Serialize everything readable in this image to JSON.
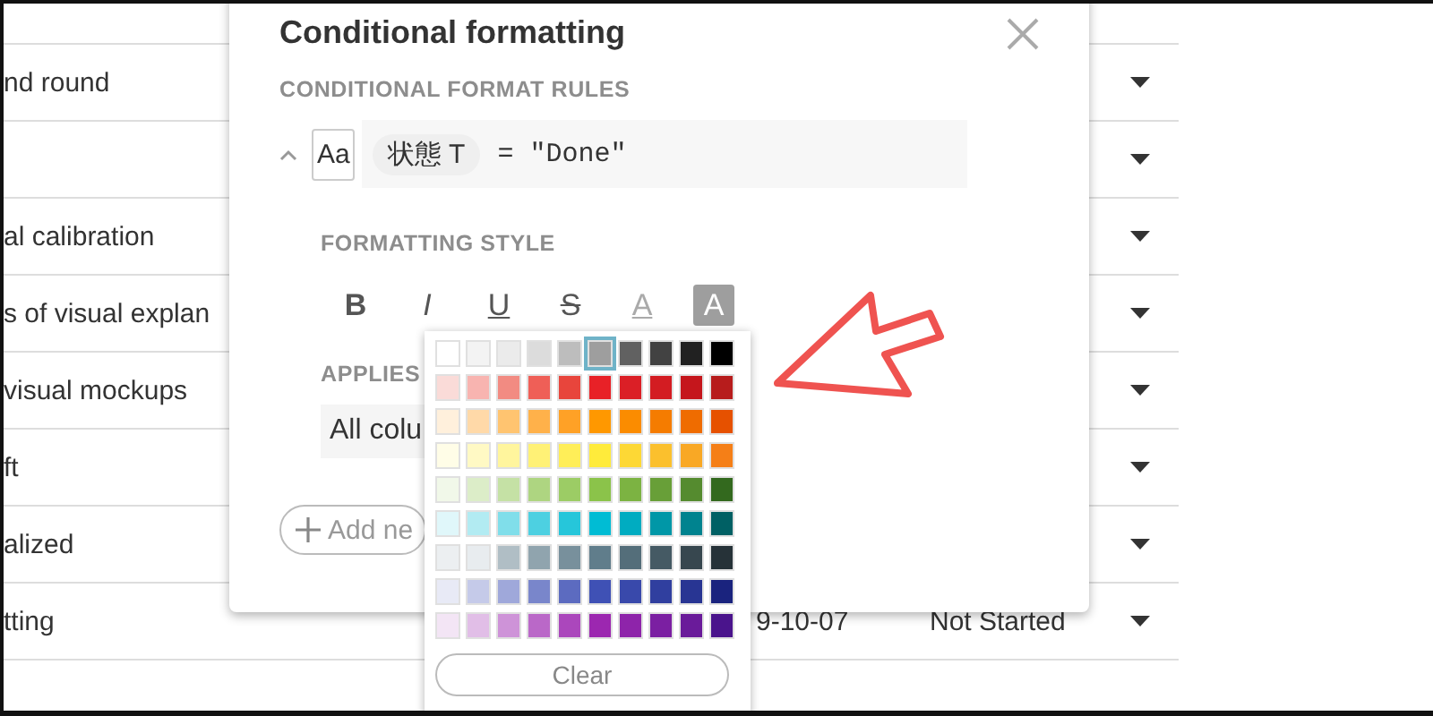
{
  "table": {
    "rows": [
      {
        "name": "nd round"
      },
      {},
      {
        "name": "al calibration"
      },
      {
        "name": "s of visual explan"
      },
      {
        "name": "visual mockups"
      },
      {
        "name": "ft"
      },
      {
        "name": "alized"
      },
      {
        "name": "tting",
        "date": "9-10-07",
        "status": "Not Started"
      }
    ]
  },
  "dialog": {
    "title": "Conditional formatting",
    "rules_heading": "CONDITIONAL FORMAT RULES",
    "rule": {
      "expanded": true,
      "format_sample": "Aa",
      "field": "状態",
      "field_type": "T",
      "condition": "= \"Done\""
    },
    "style_heading": "FORMATTING STYLE",
    "style_buttons": [
      {
        "kind": "bold",
        "label": "B",
        "selected": false
      },
      {
        "kind": "italic",
        "label": "I",
        "selected": false
      },
      {
        "kind": "underline",
        "label": "U",
        "selected": false
      },
      {
        "kind": "strike",
        "label": "S",
        "selected": false
      },
      {
        "kind": "text-color",
        "label": "A",
        "selected": false
      },
      {
        "kind": "fill-color",
        "label": "A",
        "selected": true
      }
    ],
    "applies_heading": "APPLIES",
    "applies_value": "All colu",
    "add_button": "Add ne"
  },
  "palette": {
    "rows": [
      {
        "swatches": [
          {
            "color": "#ffffff",
            "selected": false
          },
          {
            "color": "#f3f3f3",
            "selected": false
          },
          {
            "color": "#ebebeb",
            "selected": false
          },
          {
            "color": "#dcdcdc",
            "selected": false
          },
          {
            "color": "#bdbdbd",
            "selected": false
          },
          {
            "color": "#9e9e9e",
            "selected": true
          },
          {
            "color": "#616161",
            "selected": false
          },
          {
            "color": "#424242",
            "selected": false
          },
          {
            "color": "#212121",
            "selected": false
          },
          {
            "color": "#000000",
            "selected": false
          }
        ]
      },
      {
        "swatches": [
          {
            "color": "#fadbd8",
            "selected": false
          },
          {
            "color": "#f8b4b0",
            "selected": false
          },
          {
            "color": "#f28b82",
            "selected": false
          },
          {
            "color": "#ef5f57",
            "selected": false
          },
          {
            "color": "#e8453c",
            "selected": false
          },
          {
            "color": "#e82127",
            "selected": false
          },
          {
            "color": "#db1f26",
            "selected": false
          },
          {
            "color": "#d31c22",
            "selected": false
          },
          {
            "color": "#c5161c",
            "selected": false
          },
          {
            "color": "#b71c1c",
            "selected": false
          }
        ]
      },
      {
        "swatches": [
          {
            "color": "#fff0dc",
            "selected": false
          },
          {
            "color": "#ffd9a8",
            "selected": false
          },
          {
            "color": "#ffc470",
            "selected": false
          },
          {
            "color": "#ffb14a",
            "selected": false
          },
          {
            "color": "#ffa126",
            "selected": false
          },
          {
            "color": "#ff9800",
            "selected": false
          },
          {
            "color": "#fb8c00",
            "selected": false
          },
          {
            "color": "#f57c00",
            "selected": false
          },
          {
            "color": "#ef6c00",
            "selected": false
          },
          {
            "color": "#e65100",
            "selected": false
          }
        ]
      },
      {
        "swatches": [
          {
            "color": "#fffde7",
            "selected": false
          },
          {
            "color": "#fff9c4",
            "selected": false
          },
          {
            "color": "#fff59d",
            "selected": false
          },
          {
            "color": "#fff176",
            "selected": false
          },
          {
            "color": "#ffee58",
            "selected": false
          },
          {
            "color": "#ffeb3b",
            "selected": false
          },
          {
            "color": "#fdd835",
            "selected": false
          },
          {
            "color": "#fbc02d",
            "selected": false
          },
          {
            "color": "#f9a825",
            "selected": false
          },
          {
            "color": "#f57f17",
            "selected": false
          }
        ]
      },
      {
        "swatches": [
          {
            "color": "#f1f8e9",
            "selected": false
          },
          {
            "color": "#dcedc8",
            "selected": false
          },
          {
            "color": "#c5e1a5",
            "selected": false
          },
          {
            "color": "#aed581",
            "selected": false
          },
          {
            "color": "#9ccc65",
            "selected": false
          },
          {
            "color": "#8bc34a",
            "selected": false
          },
          {
            "color": "#7cb342",
            "selected": false
          },
          {
            "color": "#689f38",
            "selected": false
          },
          {
            "color": "#558b2f",
            "selected": false
          },
          {
            "color": "#33691e",
            "selected": false
          }
        ]
      },
      {
        "swatches": [
          {
            "color": "#e0f7fa",
            "selected": false
          },
          {
            "color": "#b2ebf2",
            "selected": false
          },
          {
            "color": "#80deea",
            "selected": false
          },
          {
            "color": "#4dd0e1",
            "selected": false
          },
          {
            "color": "#26c6da",
            "selected": false
          },
          {
            "color": "#00bcd4",
            "selected": false
          },
          {
            "color": "#00acc1",
            "selected": false
          },
          {
            "color": "#0097a7",
            "selected": false
          },
          {
            "color": "#00838f",
            "selected": false
          },
          {
            "color": "#006064",
            "selected": false
          }
        ]
      },
      {
        "swatches": [
          {
            "color": "#eceff1",
            "selected": false
          },
          {
            "color": "#e8ecef",
            "selected": false
          },
          {
            "color": "#b0bec5",
            "selected": false
          },
          {
            "color": "#90a4ae",
            "selected": false
          },
          {
            "color": "#78909c",
            "selected": false
          },
          {
            "color": "#607d8b",
            "selected": false
          },
          {
            "color": "#546e7a",
            "selected": false
          },
          {
            "color": "#455a64",
            "selected": false
          },
          {
            "color": "#37474f",
            "selected": false
          },
          {
            "color": "#263238",
            "selected": false
          }
        ]
      },
      {
        "swatches": [
          {
            "color": "#e8eaf6",
            "selected": false
          },
          {
            "color": "#c5cae9",
            "selected": false
          },
          {
            "color": "#9fa8da",
            "selected": false
          },
          {
            "color": "#7986cb",
            "selected": false
          },
          {
            "color": "#5c6bc0",
            "selected": false
          },
          {
            "color": "#3f51b5",
            "selected": false
          },
          {
            "color": "#3949ab",
            "selected": false
          },
          {
            "color": "#303f9f",
            "selected": false
          },
          {
            "color": "#283593",
            "selected": false
          },
          {
            "color": "#1a237e",
            "selected": false
          }
        ]
      },
      {
        "swatches": [
          {
            "color": "#f3e5f5",
            "selected": false
          },
          {
            "color": "#e1bee7",
            "selected": false
          },
          {
            "color": "#ce93d8",
            "selected": false
          },
          {
            "color": "#ba68c8",
            "selected": false
          },
          {
            "color": "#ab47bc",
            "selected": false
          },
          {
            "color": "#9c27b0",
            "selected": false
          },
          {
            "color": "#8e24aa",
            "selected": false
          },
          {
            "color": "#7b1fa2",
            "selected": false
          },
          {
            "color": "#6a1b9a",
            "selected": false
          },
          {
            "color": "#4a148c",
            "selected": false
          }
        ]
      }
    ],
    "clear_button": "Clear"
  }
}
